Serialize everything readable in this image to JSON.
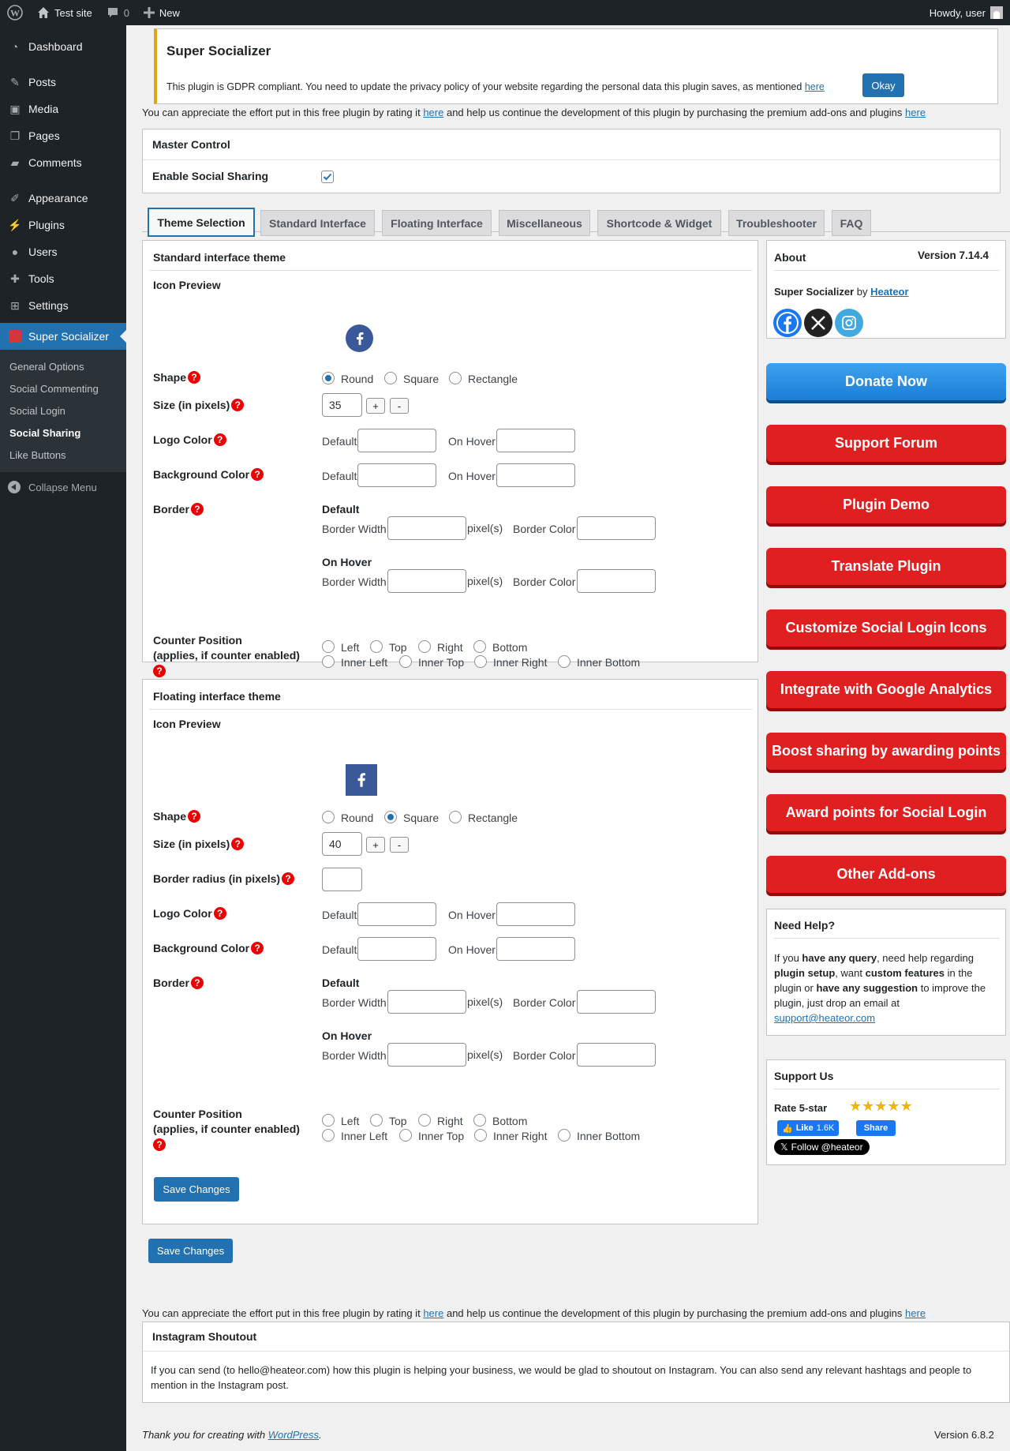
{
  "adminbar": {
    "site": "Test site",
    "comments_count": "0",
    "new_label": "New",
    "howdy": "Howdy, user"
  },
  "sidebar": {
    "items": [
      "Dashboard",
      "Posts",
      "Media",
      "Pages",
      "Comments",
      "Appearance",
      "Plugins",
      "Users",
      "Tools",
      "Settings",
      "Super Socializer"
    ],
    "submenu": [
      "General Options",
      "Social Commenting",
      "Social Login",
      "Social Sharing",
      "Like Buttons"
    ],
    "collapse": "Collapse Menu"
  },
  "notice": {
    "title": "Super Socializer",
    "text": "This plugin is GDPR compliant. You need to update the privacy policy of your website regarding the personal data this plugin saves, as mentioned",
    "link": "here",
    "button": "Okay"
  },
  "appreciate": {
    "text1": "You can appreciate the effort put in this free plugin by rating it",
    "link1": "here",
    "text2": "and help us continue the development of this plugin by purchasing the premium add-ons and plugins",
    "link2": "here"
  },
  "master": {
    "title": "Master Control",
    "enable_label": "Enable Social Sharing"
  },
  "tabs": [
    "Theme Selection",
    "Standard Interface",
    "Floating Interface",
    "Miscellaneous",
    "Shortcode & Widget",
    "Troubleshooter",
    "FAQ"
  ],
  "standard": {
    "title": "Standard interface theme",
    "icon_preview": "Icon Preview",
    "shape": "Shape",
    "shape_options": [
      "Round",
      "Square",
      "Rectangle"
    ],
    "shape_selected": "Round",
    "size": "Size (in pixels)",
    "size_value": "35",
    "plus": "+",
    "minus": "-",
    "logo_color": "Logo Color",
    "bg_color": "Background Color",
    "default": "Default",
    "on_hover": "On Hover",
    "border": "Border",
    "border_default": "Default",
    "border_hover": "On Hover",
    "border_width": "Border Width",
    "pixels": "pixel(s)",
    "border_color": "Border Color",
    "counter": "Counter Position",
    "counter_note": "(applies, if counter enabled)",
    "counter_options": [
      "Left",
      "Top",
      "Right",
      "Bottom",
      "Inner Left",
      "Inner Top",
      "Inner Right",
      "Inner Bottom"
    ]
  },
  "floating": {
    "title": "Floating interface theme",
    "icon_preview": "Icon Preview",
    "shape": "Shape",
    "shape_options": [
      "Round",
      "Square",
      "Rectangle"
    ],
    "shape_selected": "Square",
    "size": "Size (in pixels)",
    "size_value": "40",
    "plus": "+",
    "minus": "-",
    "radius": "Border radius (in pixels)",
    "logo_color": "Logo Color",
    "bg_color": "Background Color",
    "default": "Default",
    "on_hover": "On Hover",
    "border": "Border",
    "border_default": "Default",
    "border_hover": "On Hover",
    "border_width": "Border Width",
    "pixels": "pixel(s)",
    "border_color": "Border Color",
    "counter": "Counter Position",
    "counter_note": "(applies, if counter enabled)",
    "counter_options": [
      "Left",
      "Top",
      "Right",
      "Bottom",
      "Inner Left",
      "Inner Top",
      "Inner Right",
      "Inner Bottom"
    ],
    "save": "Save Changes"
  },
  "save_main": "Save Changes",
  "about": {
    "title": "About",
    "version": "Version 7.14.4",
    "name": "Super Socializer",
    "by": "by",
    "author": "Heateor"
  },
  "promo_buttons": [
    "Donate Now",
    "Support Forum",
    "Plugin Demo",
    "Translate Plugin",
    "Customize Social Login Icons",
    "Integrate with Google Analytics",
    "Boost sharing by awarding points",
    "Award points for Social Login",
    "Other Add-ons"
  ],
  "help": {
    "title": "Need Help?",
    "p1": "If you",
    "b1": "have any query",
    "p2": ", need help regarding",
    "b2": "plugin setup",
    "p3": ", want",
    "b3": "custom features",
    "p4": "in the plugin or",
    "b4": "have any suggestion",
    "p5": "to improve the plugin, just drop an email at",
    "email": "support@heateor.com"
  },
  "support": {
    "title": "Support Us",
    "rate": "Rate 5-star",
    "like": "Like",
    "like_count": "1.6K",
    "share": "Share",
    "follow": "Follow @heateor"
  },
  "instagram": {
    "title": "Instagram Shoutout",
    "text": "If you can send (to hello@heateor.com) how this plugin is helping your business, we would be glad to shoutout on Instagram. You can also send any relevant hashtags and people to mention in the Instagram post."
  },
  "footer": {
    "thanks": "Thank you for creating with",
    "wp": "WordPress",
    "version": "Version 6.8.2"
  },
  "colors": {
    "primary": "#2271b1",
    "red": "#e02020",
    "admin_dark": "#1d2327",
    "facebook": "#3b5998"
  }
}
